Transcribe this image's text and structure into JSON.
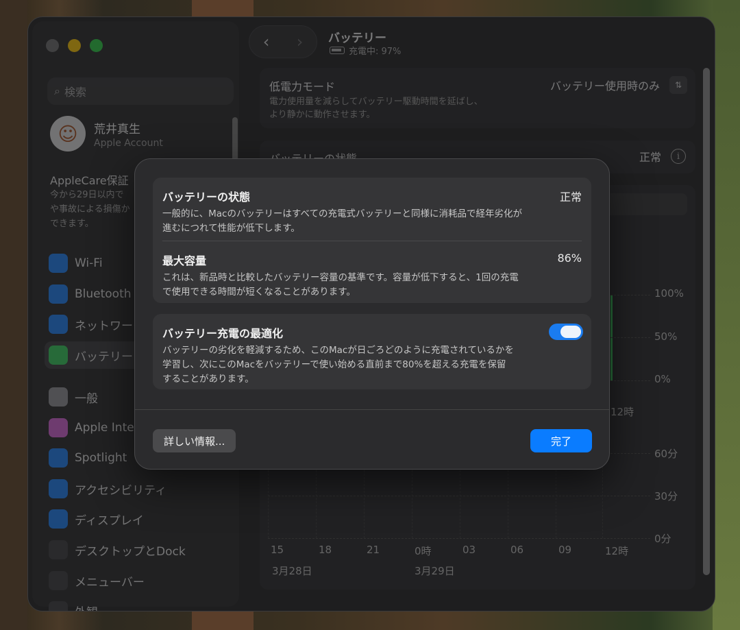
{
  "sidebar": {
    "search_placeholder": "検索",
    "account": {
      "name": "荒井真生",
      "sub": "Apple Account"
    },
    "applecare": {
      "title": "AppleCare保証",
      "desc": "今から29日以内で\nや事故による損傷か\nできます。"
    },
    "items": [
      {
        "label": "Wi-Fi",
        "icon": "wifi-icon",
        "color": "#1a7cf0"
      },
      {
        "label": "Bluetooth",
        "icon": "bluetooth-icon",
        "color": "#1a7cf0"
      },
      {
        "label": "ネットワーク",
        "icon": "globe-icon",
        "color": "#1a7cf0"
      },
      {
        "label": "バッテリー",
        "icon": "battery-icon",
        "color": "#34c759"
      },
      {
        "label": "一般",
        "icon": "gear-icon",
        "color": "#8e8e93"
      },
      {
        "label": "Apple Inte",
        "icon": "apple-intelligence-icon",
        "color": "#d05fd0"
      },
      {
        "label": "Spotlight",
        "icon": "magnifier-icon",
        "color": "#1a7cf0"
      },
      {
        "label": "アクセシビリティ",
        "icon": "accessibility-icon",
        "color": "#1a7cf0"
      },
      {
        "label": "ディスプレイ",
        "icon": "sun-icon",
        "color": "#1a7cf0"
      },
      {
        "label": "デスクトップとDock",
        "icon": "dock-icon",
        "color": "#3a3a3c"
      },
      {
        "label": "メニューバー",
        "icon": "menubar-icon",
        "color": "#3a3a3c"
      },
      {
        "label": "外観",
        "icon": "appearance-icon",
        "color": "#3a3a3c"
      }
    ]
  },
  "header": {
    "title": "バッテリー",
    "status": "充電中: 97%"
  },
  "low_power": {
    "title": "低電力モード",
    "desc": "電力使用量を減らしてバッテリー駆動時間を延ばし、\nより静かに動作させます。",
    "value": "バッテリー使用時のみ"
  },
  "health_row": {
    "title": "バッテリーの状態",
    "value": "正常"
  },
  "chart": {
    "y_top": [
      "100%",
      "50%",
      "0%"
    ],
    "y_bottom": [
      "60分",
      "30分",
      "0分"
    ],
    "x_top_partial": "12時",
    "x_ticks": [
      "15",
      "18",
      "21",
      "0時",
      "03",
      "06",
      "09",
      "12時"
    ],
    "dates": [
      "3月28日",
      "3月29日"
    ]
  },
  "modal": {
    "health": {
      "title": "バッテリーの状態",
      "value": "正常",
      "desc": "一般的に、Macのバッテリーはすべての充電式バッテリーと同様に消耗品で経年劣化が\n進むにつれて性能が低下します。"
    },
    "capacity": {
      "title": "最大容量",
      "value": "86%",
      "desc": "これは、新品時と比較したバッテリー容量の基準です。容量が低下すると、1回の充電\nで使用できる時間が短くなることがあります。"
    },
    "optimize": {
      "title": "バッテリー充電の最適化",
      "enabled": true,
      "desc": "バッテリーの劣化を軽減するため、このMacが日ごろどのように充電されているかを\n学習し、次にこのMacをバッテリーで使い始める直前まで80%を超える充電を保留\nすることがあります。"
    },
    "more_info_label": "詳しい情報...",
    "done_label": "完了"
  },
  "colors": {
    "accent": "#0a7cff",
    "toggle_on": "#1a7cf0"
  }
}
